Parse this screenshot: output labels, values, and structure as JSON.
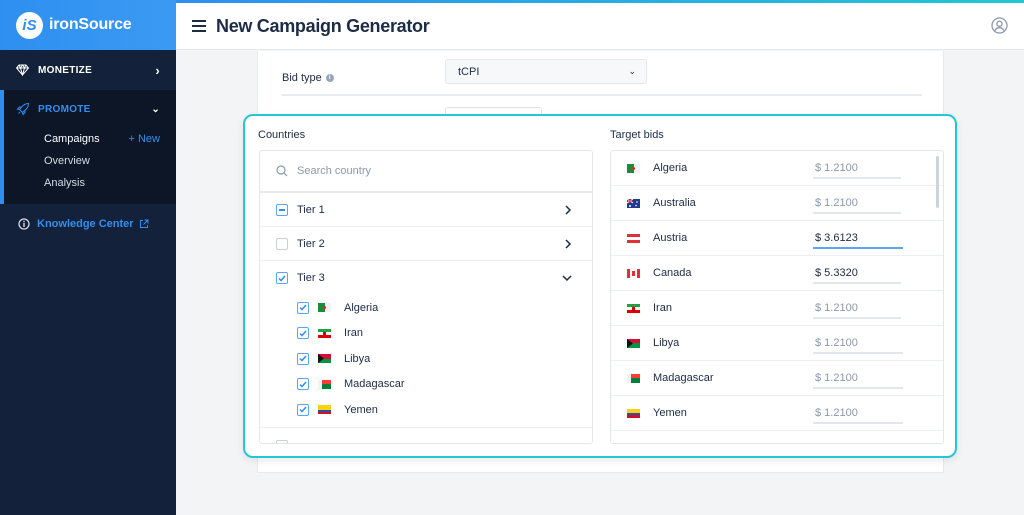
{
  "brand": {
    "logo_text": "iS",
    "name": "ironSource"
  },
  "sidebar": {
    "monetize": {
      "label": "MONETIZE",
      "icon": "diamond-icon"
    },
    "promote": {
      "label": "PROMOTE",
      "icon": "rocket-icon",
      "items": [
        {
          "label": "Campaigns",
          "action": "+ New"
        },
        {
          "label": "Overview"
        },
        {
          "label": "Analysis"
        }
      ]
    },
    "knowledge": {
      "label": "Knowledge Center",
      "icon": "info-icon"
    }
  },
  "header": {
    "title": "New Campaign Generator"
  },
  "form": {
    "bid_type_label": "Bid type",
    "bid_type_value": "tCPI"
  },
  "countries": {
    "label": "Countries",
    "search_placeholder": "Search country",
    "tiers": [
      {
        "label": "Tier 1",
        "state": "partial"
      },
      {
        "label": "Tier 2",
        "state": "unchecked"
      },
      {
        "label": "Tier 3",
        "state": "checked",
        "expanded": true
      }
    ],
    "tier3_countries": [
      {
        "name": "Algeria",
        "checked": true
      },
      {
        "name": "Iran",
        "checked": true
      },
      {
        "name": "Libya",
        "checked": true
      },
      {
        "name": "Madagascar",
        "checked": true
      },
      {
        "name": "Yemen",
        "checked": true
      }
    ]
  },
  "target_bids": {
    "label": "Target bids",
    "rows": [
      {
        "country": "Algeria",
        "bid": "$ 1.2100",
        "state": "default"
      },
      {
        "country": "Australia",
        "bid": "$ 1.2100",
        "state": "default"
      },
      {
        "country": "Austria",
        "bid": "$ 3.6123",
        "state": "focused"
      },
      {
        "country": "Canada",
        "bid": "$ 5.3320",
        "state": "filled"
      },
      {
        "country": "Iran",
        "bid": "$ 1.2100",
        "state": "default"
      },
      {
        "country": "Libya",
        "bid": "$ 1.2100",
        "state": "default"
      },
      {
        "country": "Madagascar",
        "bid": "$ 1.2100",
        "state": "default"
      },
      {
        "country": "Yemen",
        "bid": "$ 1.2100",
        "state": "default"
      }
    ]
  },
  "colors": {
    "accent": "#2f8ff0",
    "highlight_border": "#24c7d4",
    "sidebar_bg": "#13213a"
  }
}
